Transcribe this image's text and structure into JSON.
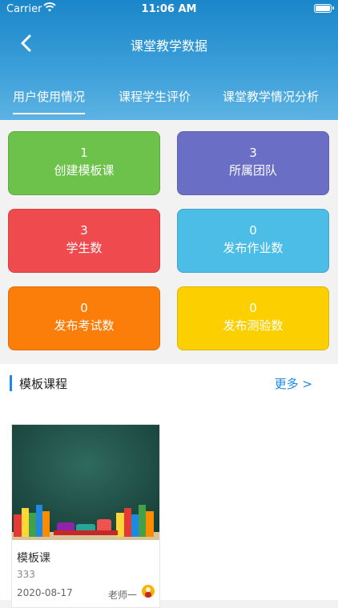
{
  "status_bar": {
    "carrier": "Carrier",
    "time": "11:06 AM"
  },
  "header": {
    "title": "课堂教学数据"
  },
  "tabs": [
    {
      "label": "用户使用情况",
      "active": true
    },
    {
      "label": "课程学生评价",
      "active": false
    },
    {
      "label": "课堂教学情况分析",
      "active": false
    }
  ],
  "stats": [
    {
      "value": "1",
      "label": "创建模板课",
      "color": "#6cc24a"
    },
    {
      "value": "3",
      "label": "所属团队",
      "color": "#6a6ec4"
    },
    {
      "value": "3",
      "label": "学生数",
      "color": "#ef4b4f"
    },
    {
      "value": "0",
      "label": "发布作业数",
      "color": "#4bbde6"
    },
    {
      "value": "0",
      "label": "发布考试数",
      "color": "#fb7d0a"
    },
    {
      "value": "0",
      "label": "发布测验数",
      "color": "#fcd000"
    }
  ],
  "section": {
    "title": "模板课程",
    "more": "更多 >"
  },
  "courses": [
    {
      "name": "模板课",
      "code": "333",
      "date": "2020-08-17",
      "teacher": "老师一"
    }
  ]
}
